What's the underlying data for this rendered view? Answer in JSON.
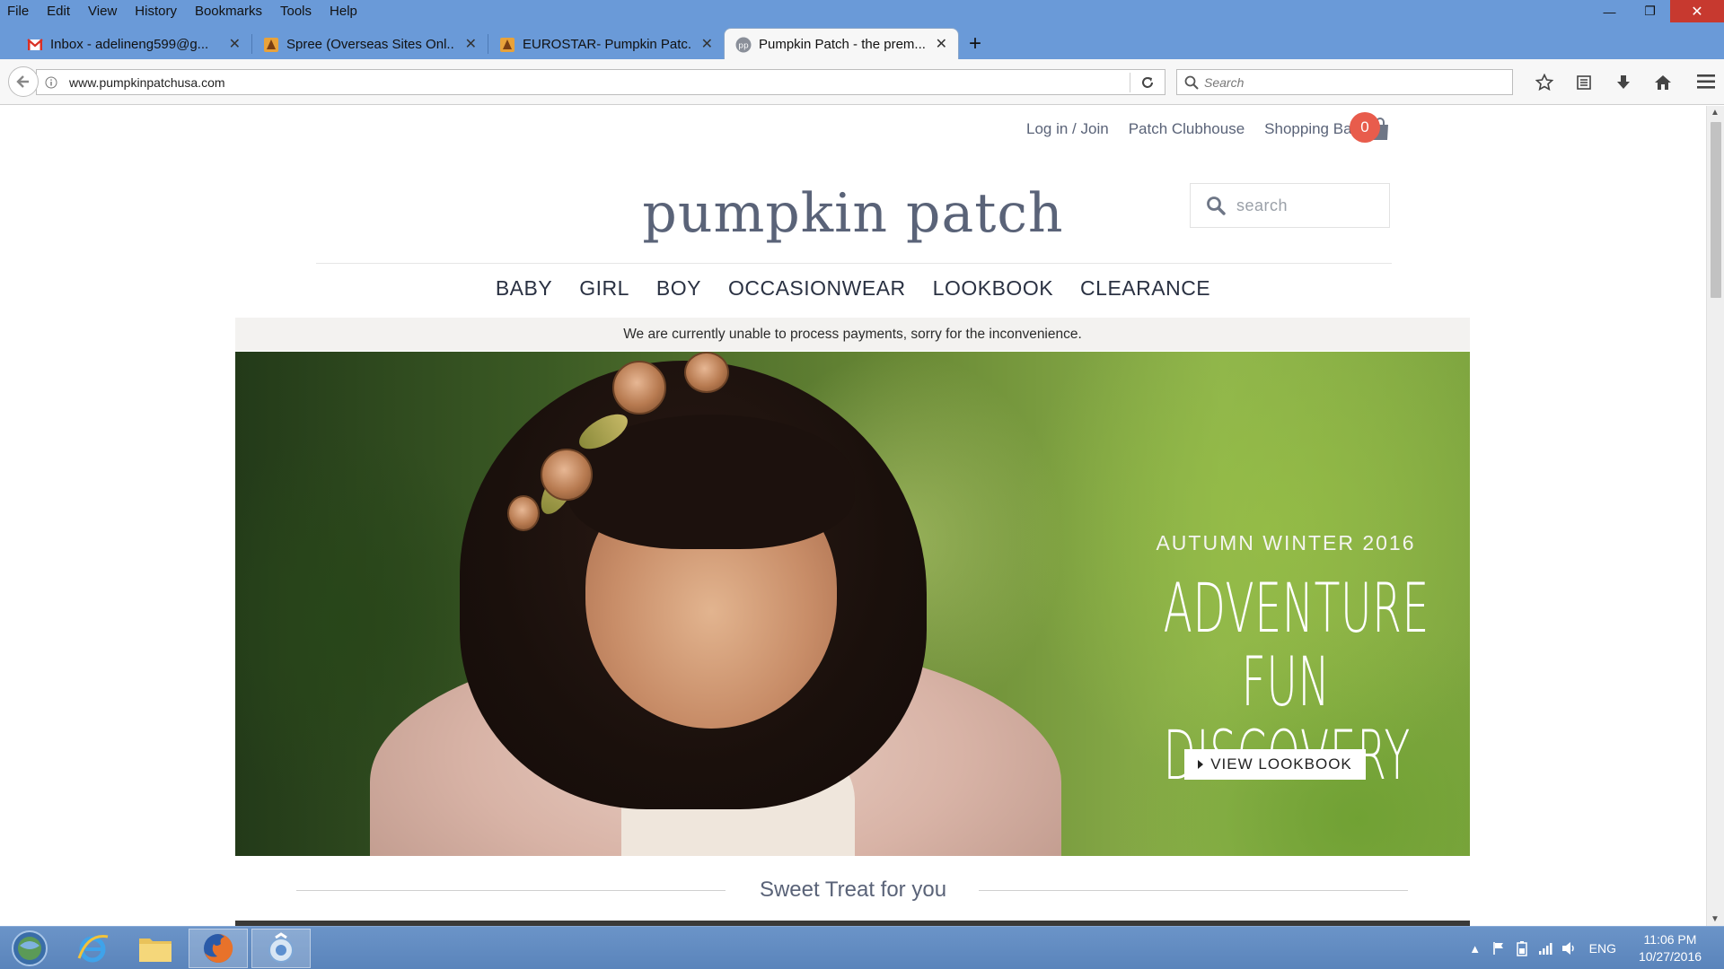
{
  "browser": {
    "menu": [
      "File",
      "Edit",
      "View",
      "History",
      "Bookmarks",
      "Tools",
      "Help"
    ],
    "tabs": [
      {
        "label": "Inbox - adelineng599@g...",
        "icon": "gmail-icon",
        "active": false
      },
      {
        "label": "Spree (Overseas Sites Onl...",
        "icon": "site-favicon",
        "active": false
      },
      {
        "label": "EUROSTAR- Pumpkin Patc...",
        "icon": "site-favicon",
        "active": false
      },
      {
        "label": "Pumpkin Patch - the prem...",
        "icon": "pp-favicon",
        "active": true
      }
    ],
    "url": "www.pumpkinpatchusa.com",
    "search_placeholder": "Search"
  },
  "site": {
    "top_links": {
      "login": "Log in / Join",
      "clubhouse": "Patch Clubhouse",
      "bag": "Shopping Bag",
      "bag_count": "0"
    },
    "logo": "pumpkin patch",
    "search_placeholder": "search",
    "nav": [
      "BABY",
      "GIRL",
      "BOY",
      "OCCASIONWEAR",
      "LOOKBOOK",
      "CLEARANCE"
    ],
    "notice": "We are currently unable to process payments, sorry for the inconvenience.",
    "hero": {
      "subtitle": "AUTUMN WINTER 2016",
      "title_line1": "ADVENTURE",
      "title_line2": "FUN DISCOVERY",
      "button": "VIEW LOOKBOOK"
    },
    "section_title": "Sweet Treat for you"
  },
  "taskbar": {
    "language": "ENG",
    "time": "11:06 PM",
    "date": "10/27/2016"
  },
  "colors": {
    "brand_text": "#5a6378",
    "bag_badge": "#e85c4c",
    "chrome_blue": "#6a9ad8"
  }
}
